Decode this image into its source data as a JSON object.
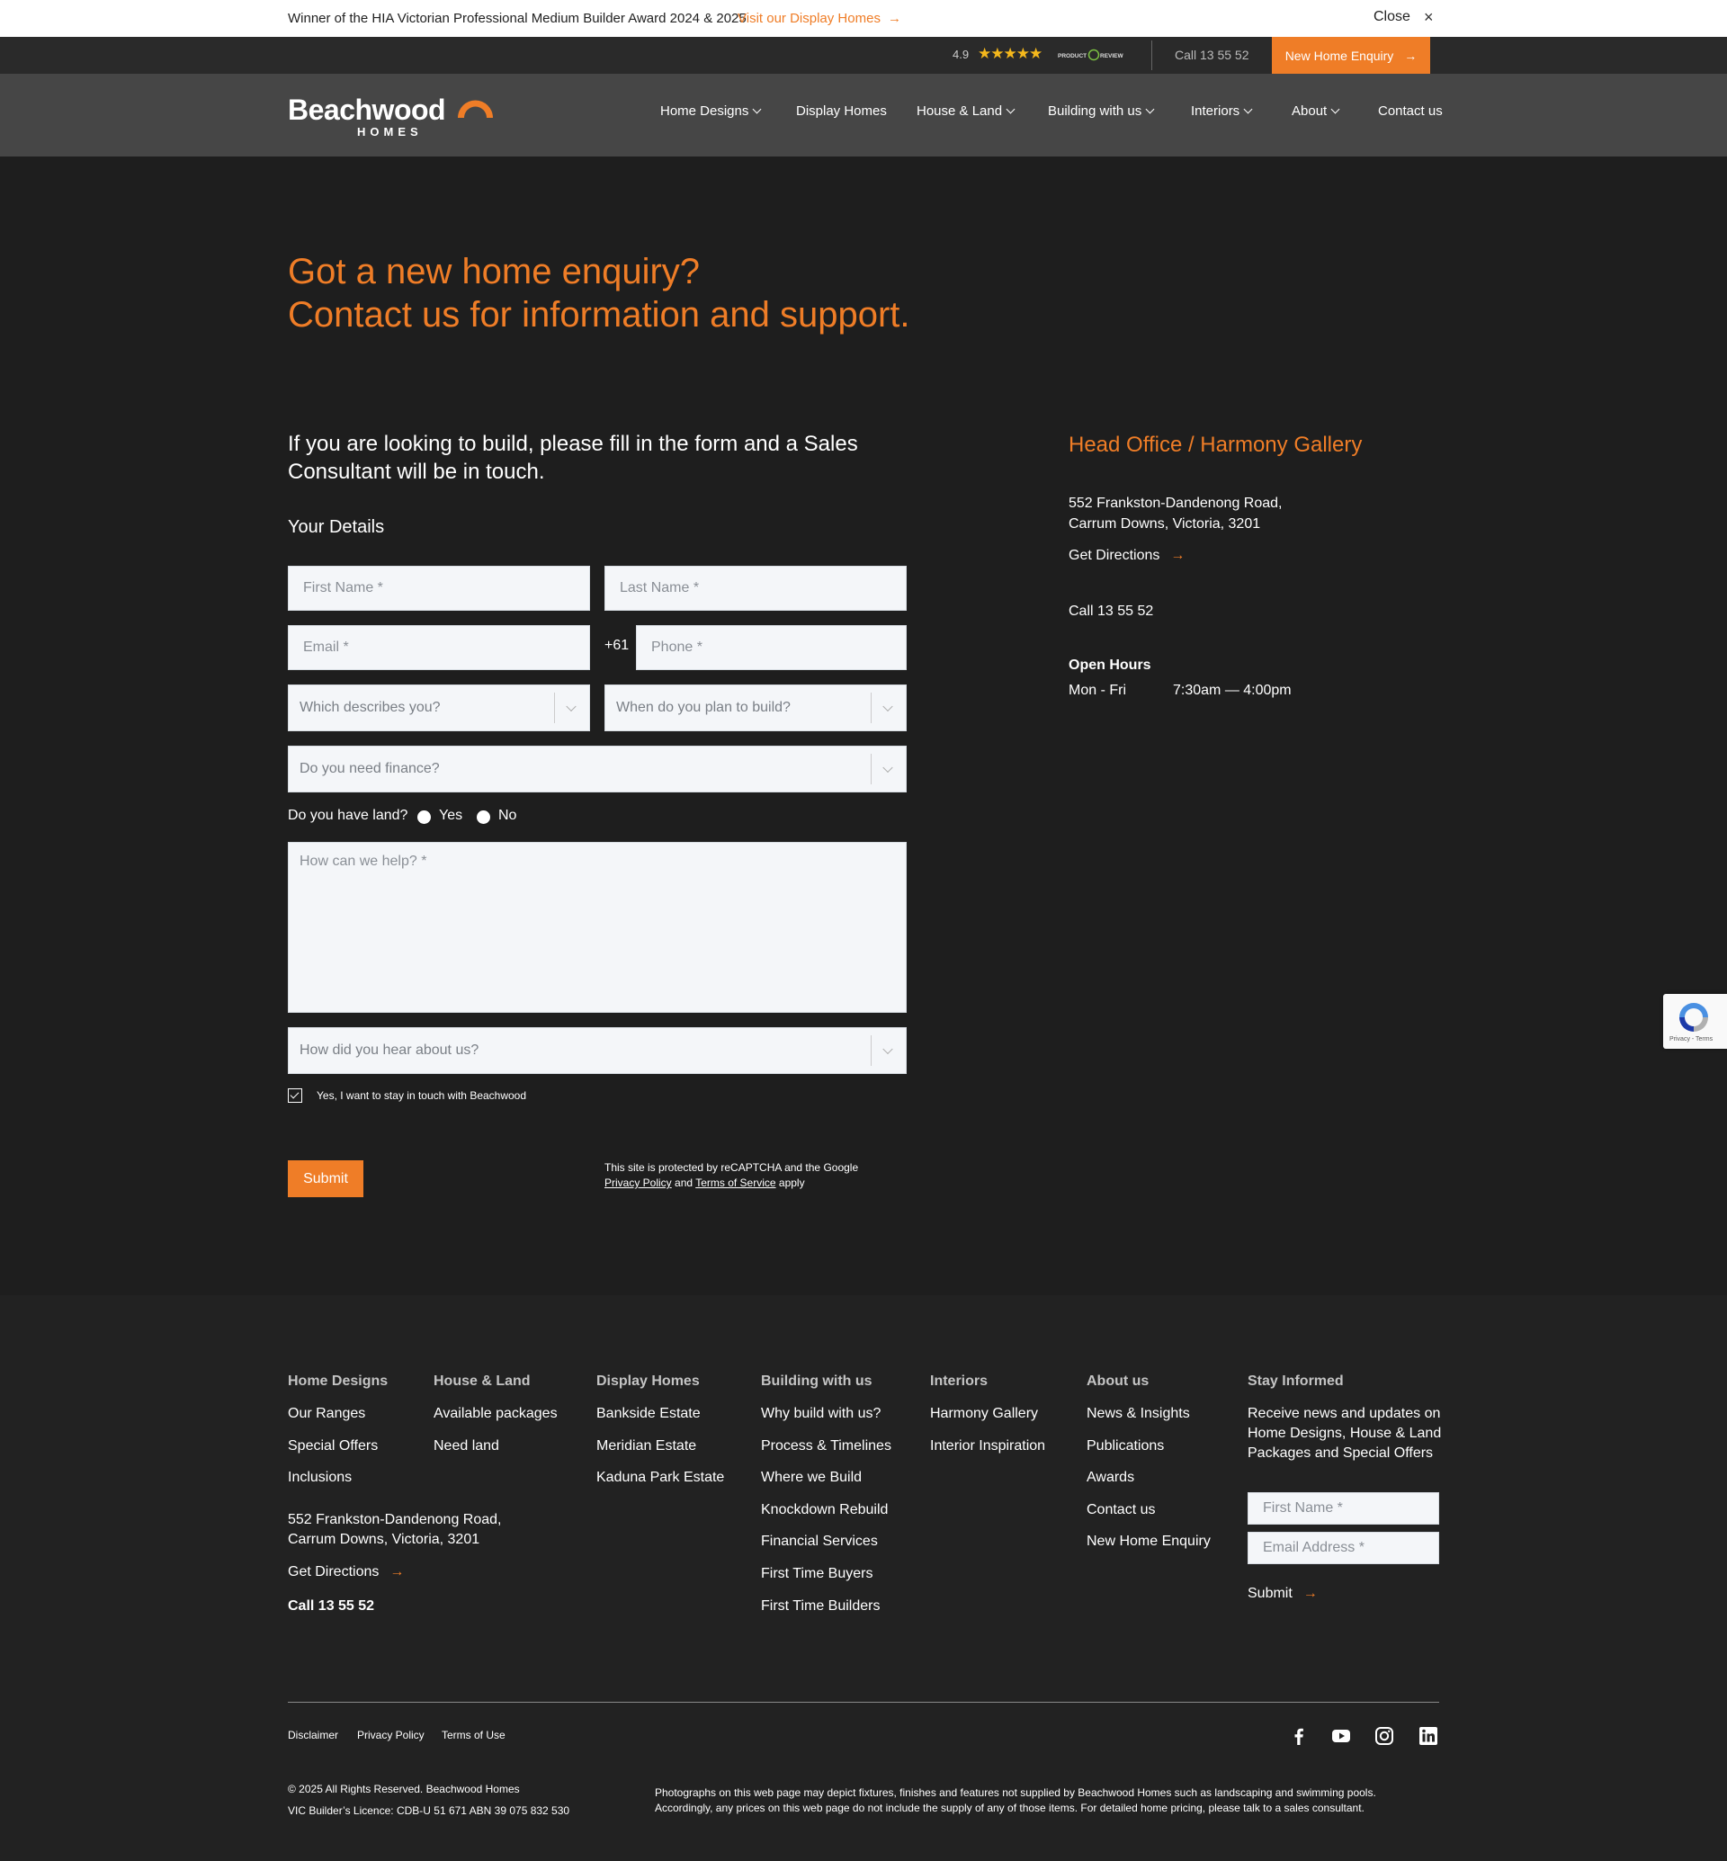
{
  "announcement": {
    "text": "Winner of the HIA Victorian Professional Medium Builder Award 2024 & 2025",
    "link": "Visit our Display Homes",
    "arrow": "→",
    "close": "Close",
    "close_icon": "×"
  },
  "utility": {
    "rating": "4.9",
    "stars": "★★★★★",
    "review_logo": "PRODUCT REVIEW",
    "call": "Call 13 55 52",
    "enquiry": "New Home Enquiry",
    "enquiry_arrow": "→"
  },
  "brand": {
    "name": "Beachwood",
    "sub": "HOMES",
    "accent": "#ef7d27"
  },
  "nav": [
    {
      "label": "Home Designs",
      "dropdown": true
    },
    {
      "label": "Display Homes",
      "dropdown": false
    },
    {
      "label": "House & Land",
      "dropdown": true
    },
    {
      "label": "Building with us",
      "dropdown": true
    },
    {
      "label": "Interiors",
      "dropdown": true
    },
    {
      "label": "About",
      "dropdown": true
    },
    {
      "label": "Contact us",
      "dropdown": false
    }
  ],
  "hero": {
    "line1": "Got a new home enquiry?",
    "line2": "Contact us for information and support."
  },
  "form": {
    "intro": "If you are looking to build, please fill in the form and a Sales Consultant will be in touch.",
    "section": "Your Details",
    "first_name": "First Name *",
    "last_name": "Last Name *",
    "email": "Email *",
    "phone_prefix": "+61",
    "phone": "Phone *",
    "describes": "Which describes you?",
    "plan": "When do you plan to build?",
    "finance": "Do you need finance?",
    "land_q": "Do you have land?",
    "yes": "Yes",
    "no": "No",
    "help": "How can we help? *",
    "hear": "How did you hear about us?",
    "stay": "Yes, I want to stay in touch with Beachwood",
    "submit": "Submit",
    "recaptcha_1": "This site is protected by reCAPTCHA and the Google",
    "privacy": "Privacy Policy",
    "and": "and",
    "terms": "Terms of Service",
    "apply": "apply"
  },
  "office": {
    "title": "Head Office / Harmony Gallery",
    "address1": "552 Frankston-Dandenong Road,",
    "address2": "Carrum Downs, Victoria, 3201",
    "directions": "Get Directions",
    "arrow": "→",
    "call": "Call 13 55 52",
    "hours_title": "Open Hours",
    "days": "Mon - Fri",
    "hours": "7:30am —  4:00pm"
  },
  "recaptcha_badge": "Privacy - Terms",
  "footer": {
    "cols": {
      "home_designs": {
        "title": "Home Designs",
        "items": [
          "Our Ranges",
          "Special Offers",
          "Inclusions"
        ]
      },
      "house_land": {
        "title": "House & Land",
        "items": [
          "Available packages",
          "Need land"
        ]
      },
      "display": {
        "title": "Display Homes",
        "items": [
          "Bankside Estate",
          "Meridian Estate",
          "Kaduna Park Estate"
        ]
      },
      "building": {
        "title": "Building with us",
        "items": [
          "Why build with us?",
          "Process & Timelines",
          "Where we Build",
          "Knockdown Rebuild",
          "Financial Services",
          "First Time Buyers",
          "First Time Builders"
        ]
      },
      "interiors": {
        "title": "Interiors",
        "items": [
          "Harmony Gallery",
          "Interior Inspiration"
        ]
      },
      "about": {
        "title": "About us",
        "items": [
          "News & Insights",
          "Publications",
          "Awards",
          "Contact us",
          "New Home Enquiry"
        ]
      },
      "stay": {
        "title": "Stay Informed",
        "text": [
          "Receive news and updates on",
          "Home Designs, House & Land",
          "Packages and Special Offers"
        ]
      }
    },
    "address1": "552 Frankston-Dandenong Road,",
    "address2": "Carrum Downs, Victoria, 3201",
    "directions": "Get Directions",
    "call": "Call 13 55 52",
    "first_name": "First Name *",
    "email": "Email Address *",
    "submit": "Submit",
    "legal": [
      "Disclaimer",
      "Privacy Policy",
      "Terms of Use"
    ],
    "social_icons": [
      "facebook-icon",
      "youtube-icon",
      "instagram-icon",
      "linkedin-icon"
    ],
    "copyright": "© 2025 All Rights Reserved. Beachwood Homes",
    "licence": "VIC Builder’s Licence: CDB-U 51 671 ABN 39 075 832 530",
    "disclaimer1": "Photographs on this web page may depict fixtures, finishes and features not supplied by Beachwood Homes such as landscaping and swimming pools.",
    "disclaimer2": "Accordingly, any prices on this web page do not include the supply of any of those items. For detailed home pricing, please talk to a sales consultant."
  }
}
